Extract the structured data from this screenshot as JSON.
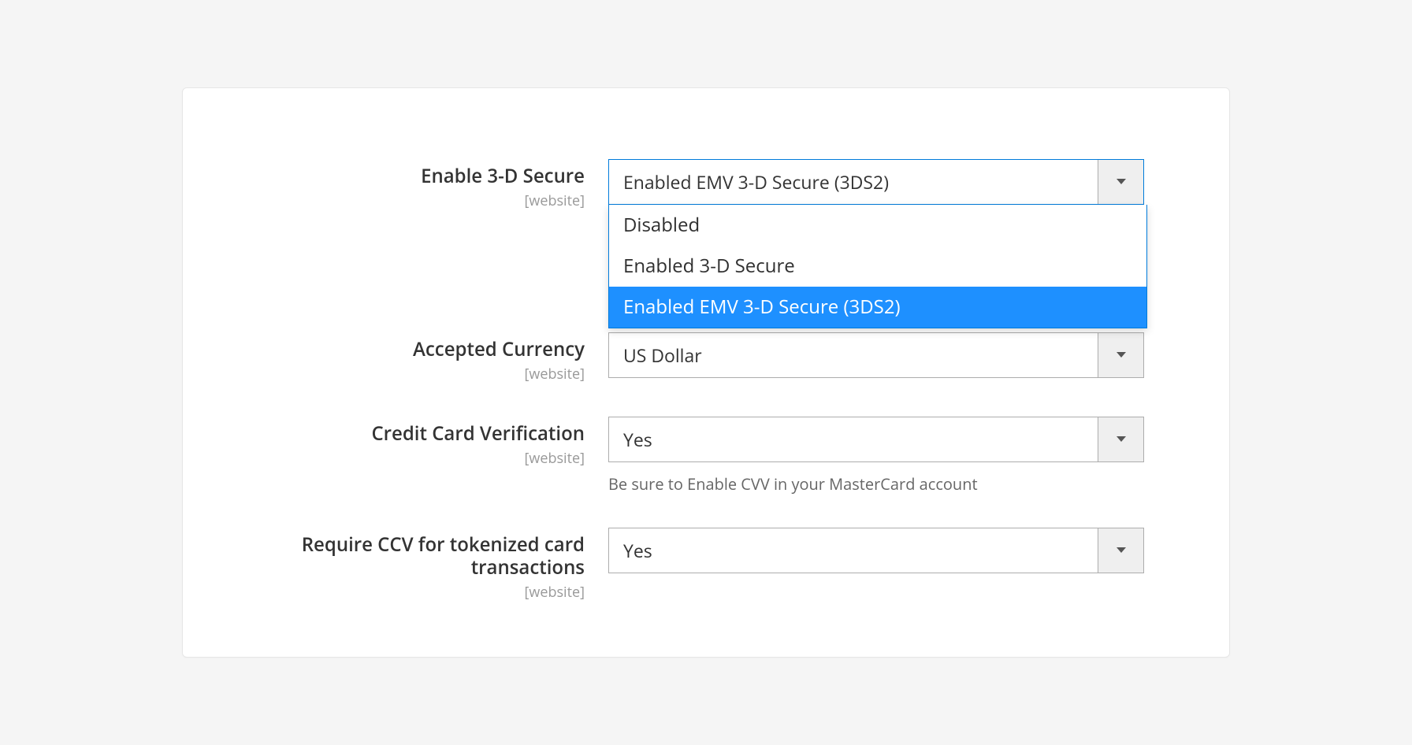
{
  "scope_label": "[website]",
  "fields": {
    "enable_3ds": {
      "label": "Enable 3-D Secure",
      "value": "Enabled EMV 3-D Secure (3DS2)",
      "options": [
        "Disabled",
        "Enabled 3-D Secure",
        "Enabled EMV 3-D Secure (3DS2)"
      ],
      "highlighted_index": 2,
      "open": true
    },
    "accepted_currency": {
      "label": "Accepted Currency",
      "value": "US Dollar"
    },
    "cc_verification": {
      "label": "Credit Card Verification",
      "value": "Yes",
      "help": "Be sure to Enable CVV in your MasterCard account"
    },
    "require_ccv": {
      "label": "Require CCV for tokenized card transactions",
      "value": "Yes"
    }
  }
}
